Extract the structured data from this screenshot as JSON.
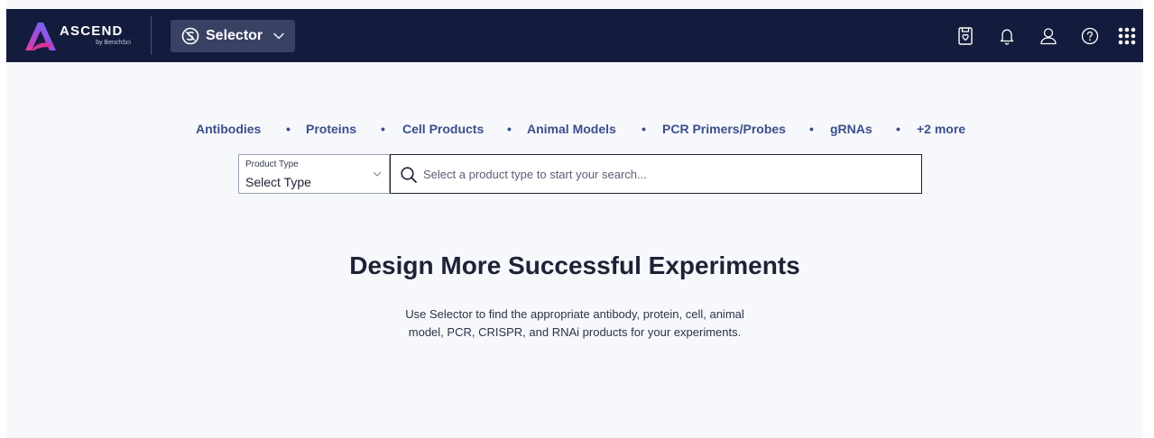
{
  "header": {
    "brand": "ASCEND",
    "brand_sub": "by BenchSci",
    "selector_label": "Selector",
    "icons": [
      "saved-document-icon",
      "bell-icon",
      "user-icon",
      "help-icon",
      "app-grid-icon"
    ]
  },
  "categories": {
    "items": [
      {
        "label": "Antibodies"
      },
      {
        "label": "Proteins"
      },
      {
        "label": "Cell Products"
      },
      {
        "label": "Animal Models"
      },
      {
        "label": "PCR Primers/Probes"
      },
      {
        "label": "gRNAs"
      },
      {
        "label": "+2 more"
      }
    ],
    "separator": "•"
  },
  "search": {
    "type_label": "Product Type",
    "type_value": "Select Type",
    "placeholder": "Select a product type to start your search..."
  },
  "hero": {
    "title": "Design More Successful Experiments",
    "description_line1": "Use Selector to find the appropriate antibody, protein, cell, animal",
    "description_line2": "model, PCR, CRISPR, and RNAi products for your experiments."
  },
  "colors": {
    "header_bg": "#141c3d",
    "selector_bg": "#3a4263",
    "link": "#3a4f8c",
    "page_bg": "#f7f8fb",
    "text_dark": "#1d2236"
  }
}
